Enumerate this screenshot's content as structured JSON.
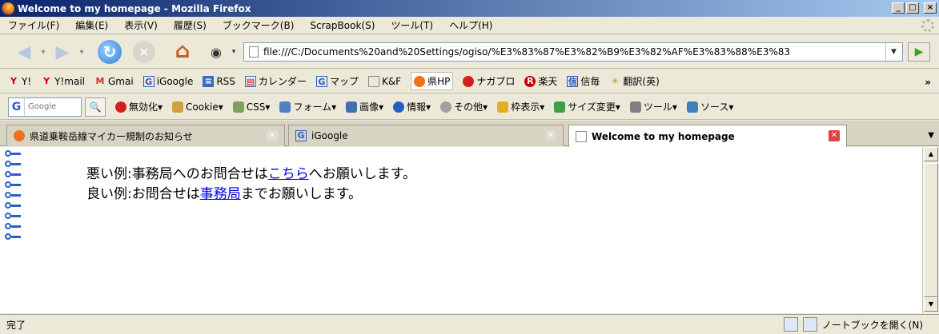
{
  "window": {
    "title": "Welcome to my homepage - Mozilla Firefox",
    "controls": {
      "minimize": "_",
      "maximize": "□",
      "close": "×"
    }
  },
  "menu": [
    "ファイル(F)",
    "編集(E)",
    "表示(V)",
    "履歴(S)",
    "ブックマーク(B)",
    "ScrapBook(S)",
    "ツール(T)",
    "ヘルプ(H)"
  ],
  "nav": {
    "url": "file:///C:/Documents%20and%20Settings/ogiso/%E3%83%87%E3%82%B9%E3%82%AF%E3%83%88%E3%83"
  },
  "bookmarks": [
    {
      "label": "Y!",
      "icon": "yahoo-icon",
      "color": "#cc0000"
    },
    {
      "label": "Y!mail",
      "icon": "yahoo-icon",
      "color": "#cc0000"
    },
    {
      "label": "Gmai",
      "icon": "gmail-icon",
      "color": "#cc3333"
    },
    {
      "label": "iGoogle",
      "icon": "google-icon",
      "color": "#2a5cc8"
    },
    {
      "label": "RSS",
      "icon": "rss-icon",
      "color": "#3a6ab8"
    },
    {
      "label": "カレンダー",
      "icon": "calendar-icon",
      "color": "#3a6ab8"
    },
    {
      "label": "マップ",
      "icon": "google-icon",
      "color": "#2a5cc8"
    },
    {
      "label": "K&F",
      "icon": "page-icon",
      "color": "#888888"
    },
    {
      "label": "県HP",
      "icon": "orange-globe-icon",
      "color": "#f07020"
    },
    {
      "label": "ナガブロ",
      "icon": "apple-icon",
      "color": "#d02020"
    },
    {
      "label": "楽天",
      "icon": "rakuten-icon",
      "color": "#c00000"
    },
    {
      "label": "信毎",
      "icon": "shinmai-icon",
      "color": "#2050c0"
    },
    {
      "label": "翻訳(英)",
      "icon": "translate-icon",
      "color": "#c09020"
    }
  ],
  "bookmarks_more": "»",
  "ext": {
    "search_placeholder": "Google",
    "items": [
      {
        "label": "無効化▾",
        "color": "#d02020"
      },
      {
        "label": "Cookie▾",
        "color": "#d0a040"
      },
      {
        "label": "CSS▾",
        "color": "#80a060"
      },
      {
        "label": "フォーム▾",
        "color": "#5080c0"
      },
      {
        "label": "画像▾",
        "color": "#4070b0"
      },
      {
        "label": "情報▾",
        "color": "#2060c0"
      },
      {
        "label": "その他▾",
        "color": "#a0a0a0"
      },
      {
        "label": "枠表示▾",
        "color": "#e0b020"
      },
      {
        "label": "サイズ変更▾",
        "color": "#40a040"
      },
      {
        "label": "ツール▾",
        "color": "#808080"
      },
      {
        "label": "ソース▾",
        "color": "#4080c0"
      }
    ]
  },
  "tabs": [
    {
      "label": "県道乗鞍岳線マイカー規制のお知らせ",
      "selected": false
    },
    {
      "label": "iGoogle",
      "selected": false
    },
    {
      "label": "Welcome to my homepage",
      "selected": true
    }
  ],
  "content": {
    "bad_prefix": "悪い例:事務局へのお問合せは",
    "bad_link": "こちら",
    "bad_suffix": "へお願いします。",
    "good_prefix": "良い例:お問合せは",
    "good_link": "事務局",
    "good_suffix": "までお願いします。"
  },
  "status": {
    "text": "完了",
    "notebook": "ノートブックを開く(N)"
  }
}
